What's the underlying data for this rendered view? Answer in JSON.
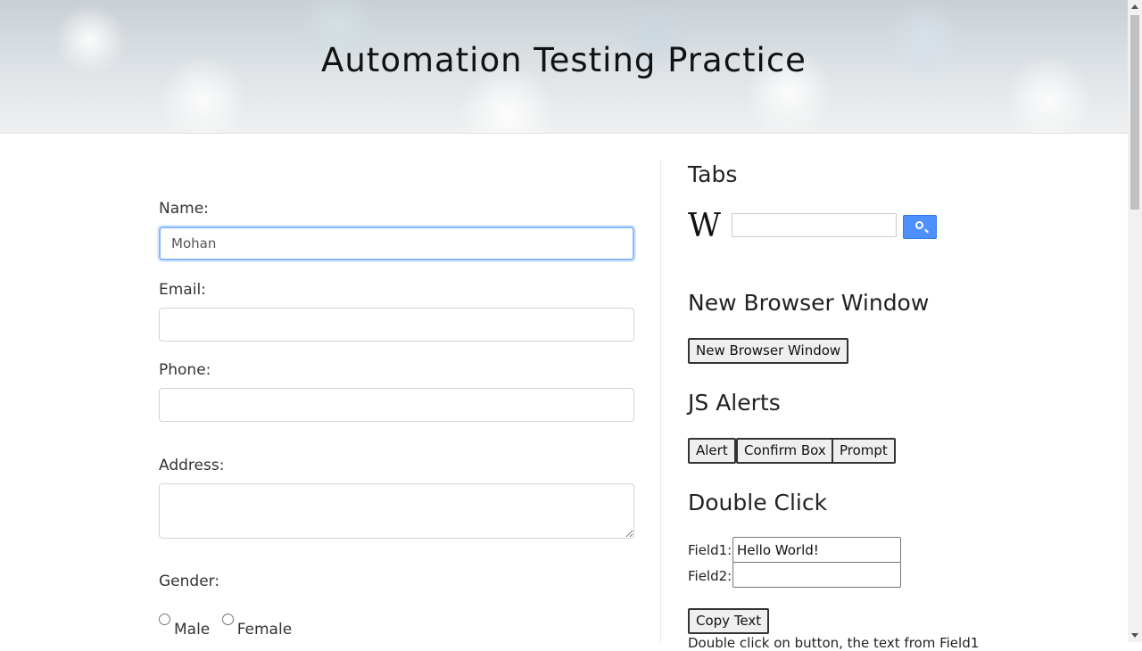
{
  "header": {
    "title": "Automation Testing Practice"
  },
  "form": {
    "name_label": "Name:",
    "name_value": "Mohan",
    "email_label": "Email:",
    "email_value": "",
    "phone_label": "Phone:",
    "phone_value": "",
    "address_label": "Address:",
    "address_value": "",
    "gender_label": "Gender:",
    "gender_options": [
      "Male",
      "Female"
    ]
  },
  "tabs": {
    "heading": "Tabs",
    "logo": "W",
    "search_value": "",
    "search_icon": "search-icon"
  },
  "browser_window": {
    "heading": "New Browser Window",
    "button_label": "New Browser Window"
  },
  "alerts": {
    "heading": "JS Alerts",
    "buttons": [
      "Alert",
      "Confirm Box",
      "Prompt"
    ]
  },
  "double_click": {
    "heading": "Double Click",
    "field1_label": "Field1:",
    "field1_value": "Hello World!",
    "field2_label": "Field2:",
    "field2_value": "",
    "copy_button": "Copy Text",
    "note": "Double click on button, the text from Field1"
  },
  "colors": {
    "focus_border": "#86b7fe",
    "search_button": "#4d90fe"
  }
}
